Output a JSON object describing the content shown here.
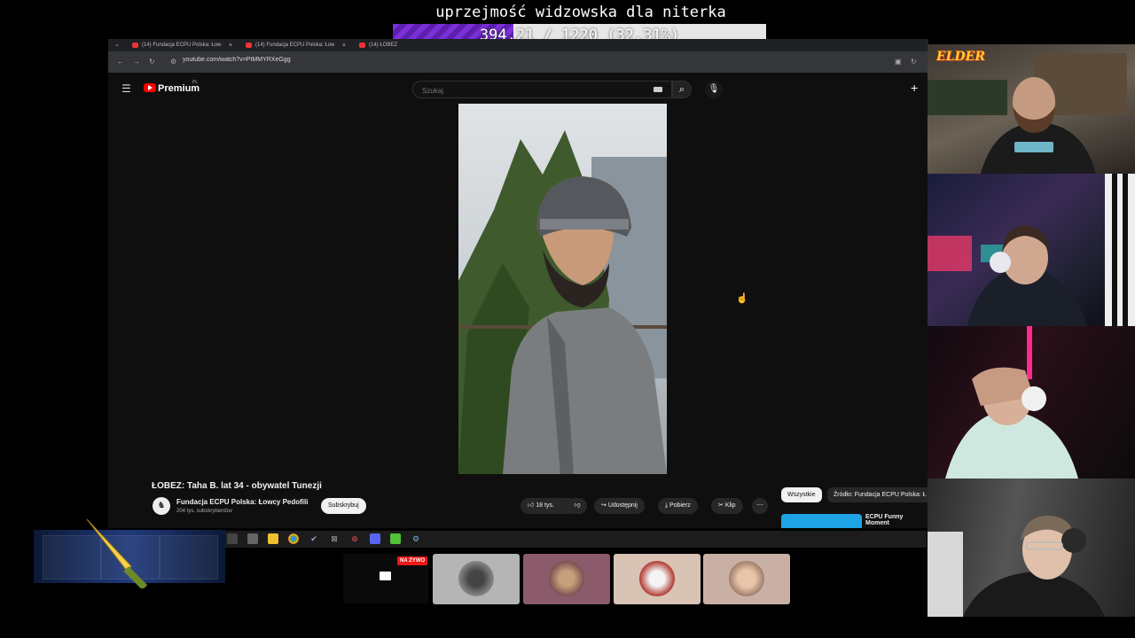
{
  "goal": {
    "title": "uprzejmość widzowska dla niterka",
    "progress_text": "394.21 / 1220 (32.31%)",
    "progress_fraction": 0.3231
  },
  "browser": {
    "tabs": [
      {
        "label": "(14) Fundacja ECPU Polska: Łow"
      },
      {
        "label": "(14) Fundacja ECPU Polska: Łow"
      },
      {
        "label": "(14) ŁOBEZ"
      }
    ],
    "url": "youtube.com/watch?v=PtMMYRXeGgg"
  },
  "youtube": {
    "brand": "Premium",
    "brand_sup": "PL",
    "search_placeholder": "Szukaj",
    "video_title": "ŁOBEZ: Taha B. lat 34 - obywatel Tunezji",
    "channel_name": "Fundacja ECPU Polska: Łowcy Pedofili",
    "channel_subs": "204 tys. subskrybentów",
    "subscribe_label": "Subskrybuj",
    "like_count": "18 tys.",
    "share_label": "Udostępnij",
    "download_label": "Pobierz",
    "clip_label": "Klip",
    "chip_all": "Wszystkie",
    "chip_source": "Źródło: Fundacja ECPU Polska: Ł",
    "rec_title": "ECPU Funny Moment"
  },
  "cams": {
    "logo_text": "ELDER"
  },
  "streams": {
    "live_badge": "NA ŻYWO"
  },
  "colors": {
    "goal_fill": "#7b2fd6",
    "yt_red": "#ff0000",
    "live_red": "#e91916"
  }
}
